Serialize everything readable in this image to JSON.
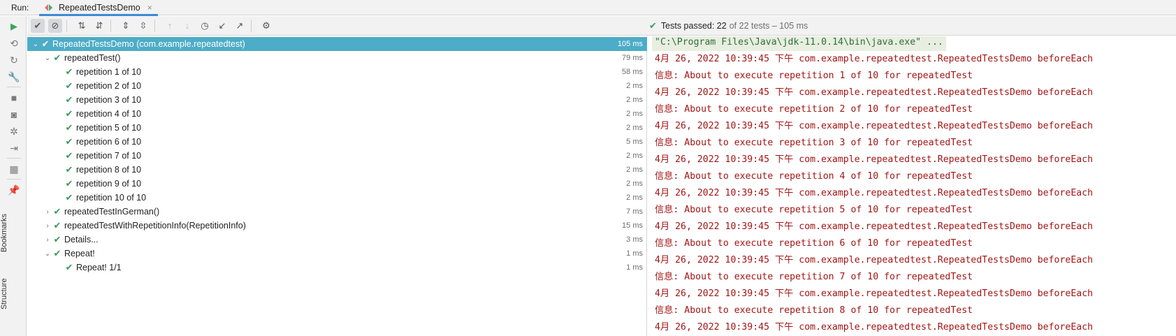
{
  "tab_bar": {
    "run_label": "Run:",
    "tab_title": "RepeatedTestsDemo",
    "tab_close": "×"
  },
  "left_strip": {
    "vertical_tabs": [
      "Bookmarks",
      "Structure"
    ]
  },
  "toolbar": {
    "status_passed": "Tests passed: 22",
    "status_rest": "of 22 tests – 105 ms"
  },
  "tree": {
    "rows": [
      {
        "name": "RepeatedTestsDemo (com.example.repeatedtest)",
        "time": "105 ms",
        "level": 0,
        "expanded": true,
        "selected": true
      },
      {
        "name": "repeatedTest()",
        "time": "79 ms",
        "level": 1,
        "expanded": true
      },
      {
        "name": "repetition 1 of 10",
        "time": "58 ms",
        "level": 2
      },
      {
        "name": "repetition 2 of 10",
        "time": "2 ms",
        "level": 2
      },
      {
        "name": "repetition 3 of 10",
        "time": "2 ms",
        "level": 2
      },
      {
        "name": "repetition 4 of 10",
        "time": "2 ms",
        "level": 2
      },
      {
        "name": "repetition 5 of 10",
        "time": "2 ms",
        "level": 2
      },
      {
        "name": "repetition 6 of 10",
        "time": "5 ms",
        "level": 2
      },
      {
        "name": "repetition 7 of 10",
        "time": "2 ms",
        "level": 2
      },
      {
        "name": "repetition 8 of 10",
        "time": "2 ms",
        "level": 2
      },
      {
        "name": "repetition 9 of 10",
        "time": "2 ms",
        "level": 2
      },
      {
        "name": "repetition 10 of 10",
        "time": "2 ms",
        "level": 2
      },
      {
        "name": "repeatedTestInGerman()",
        "time": "7 ms",
        "level": 1,
        "expanded": false
      },
      {
        "name": "repeatedTestWithRepetitionInfo(RepetitionInfo)",
        "time": "15 ms",
        "level": 1,
        "expanded": false
      },
      {
        "name": "Details...",
        "time": "3 ms",
        "level": 1,
        "expanded": false
      },
      {
        "name": "Repeat!",
        "time": "1 ms",
        "level": 1,
        "expanded": true
      },
      {
        "name": "Repeat! 1/1",
        "time": "1 ms",
        "level": 2
      }
    ]
  },
  "console": {
    "lines": [
      {
        "text": "\"C:\\Program Files\\Java\\jdk-11.0.14\\bin\\java.exe\" ...",
        "kind": "cmd"
      },
      {
        "text": "4月 26, 2022 10:39:45 下午 com.example.repeatedtest.RepeatedTestsDemo beforeEach",
        "kind": "err"
      },
      {
        "text": "信息: About to execute repetition 1 of 10 for repeatedTest",
        "kind": "err"
      },
      {
        "text": "4月 26, 2022 10:39:45 下午 com.example.repeatedtest.RepeatedTestsDemo beforeEach",
        "kind": "err"
      },
      {
        "text": "信息: About to execute repetition 2 of 10 for repeatedTest",
        "kind": "err"
      },
      {
        "text": "4月 26, 2022 10:39:45 下午 com.example.repeatedtest.RepeatedTestsDemo beforeEach",
        "kind": "err"
      },
      {
        "text": "信息: About to execute repetition 3 of 10 for repeatedTest",
        "kind": "err"
      },
      {
        "text": "4月 26, 2022 10:39:45 下午 com.example.repeatedtest.RepeatedTestsDemo beforeEach",
        "kind": "err"
      },
      {
        "text": "信息: About to execute repetition 4 of 10 for repeatedTest",
        "kind": "err"
      },
      {
        "text": "4月 26, 2022 10:39:45 下午 com.example.repeatedtest.RepeatedTestsDemo beforeEach",
        "kind": "err"
      },
      {
        "text": "信息: About to execute repetition 5 of 10 for repeatedTest",
        "kind": "err"
      },
      {
        "text": "4月 26, 2022 10:39:45 下午 com.example.repeatedtest.RepeatedTestsDemo beforeEach",
        "kind": "err"
      },
      {
        "text": "信息: About to execute repetition 6 of 10 for repeatedTest",
        "kind": "err"
      },
      {
        "text": "4月 26, 2022 10:39:45 下午 com.example.repeatedtest.RepeatedTestsDemo beforeEach",
        "kind": "err"
      },
      {
        "text": "信息: About to execute repetition 7 of 10 for repeatedTest",
        "kind": "err"
      },
      {
        "text": "4月 26, 2022 10:39:45 下午 com.example.repeatedtest.RepeatedTestsDemo beforeEach",
        "kind": "err"
      },
      {
        "text": "信息: About to execute repetition 8 of 10 for repeatedTest",
        "kind": "err"
      },
      {
        "text": "4月 26, 2022 10:39:45 下午 com.example.repeatedtest.RepeatedTestsDemo beforeEach",
        "kind": "err"
      }
    ]
  }
}
